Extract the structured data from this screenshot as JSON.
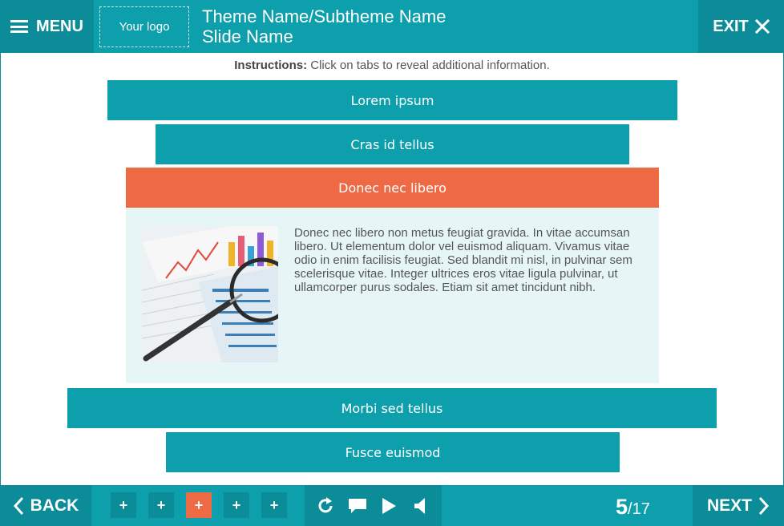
{
  "header": {
    "menu_label": "MENU",
    "logo_text": "Your logo",
    "title": "Theme Name/Subtheme Name",
    "subtitle": "Slide Name",
    "exit_label": "EXIT"
  },
  "instructions": {
    "prefix": "Instructions:",
    "text": "Click on tabs to reveal additional information."
  },
  "tabs": [
    {
      "label": "Lorem ipsum"
    },
    {
      "label": "Cras id tellus"
    },
    {
      "label": "Donec nec libero"
    },
    {
      "label": "Morbi sed tellus"
    },
    {
      "label": "Fusce euismod"
    }
  ],
  "panel": {
    "text": "Donec nec libero non metus feugiat gravida. In vitae accumsan libero. Ut elementum dolor vel euismod aliquam. Vivamus vitae odio in enim facilisis feugiat. Sed blandit mi nisl, in pulvinar sem scelerisque vitae. Integer ultrices eros vitae ligula pulvinar, ut ullamcorper purus sodales. Etiam sit amet tincidunt nibh."
  },
  "footer": {
    "back_label": "BACK",
    "next_label": "NEXT",
    "pager": [
      "+",
      "+",
      "+",
      "+",
      "+"
    ],
    "current_page": "5",
    "total_pages": "/17",
    "controls": [
      "replay-icon",
      "comment-icon",
      "play-icon",
      "volume-icon"
    ]
  },
  "colors": {
    "teal": "#0e9fad",
    "teal_dark": "#0b8c98",
    "accent": "#ee6a45",
    "panel_bg": "#e6f6f6"
  }
}
